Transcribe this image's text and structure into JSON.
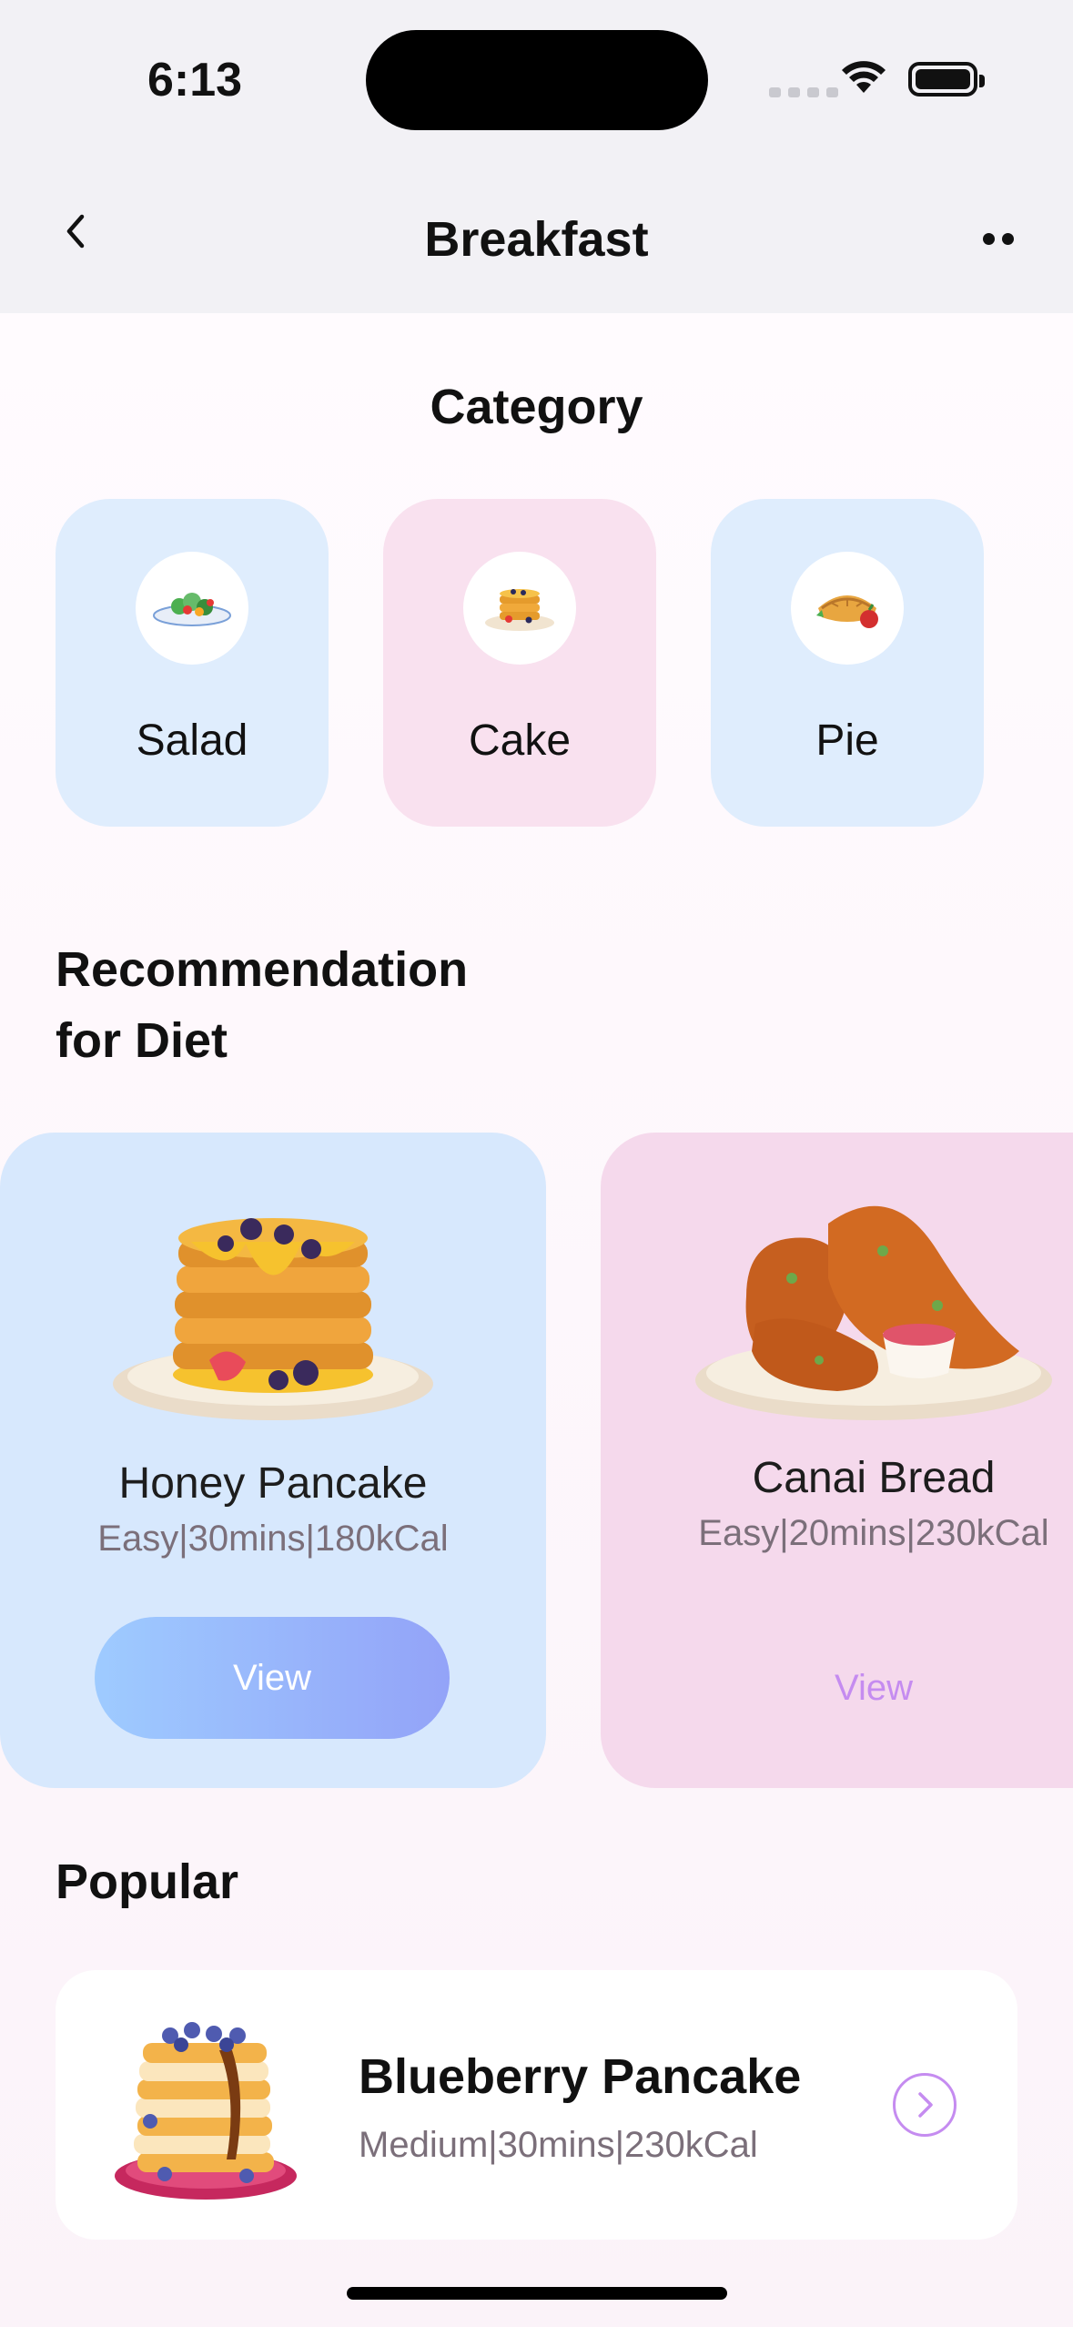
{
  "status_bar": {
    "time": "6:13"
  },
  "nav": {
    "title": "Breakfast",
    "back_icon": "chevron-left-icon",
    "more_icon": "more-dots-icon"
  },
  "category": {
    "heading": "Category",
    "items": [
      {
        "label": "Salad",
        "color": "#dfedfd",
        "icon": "salad-icon"
      },
      {
        "label": "Cake",
        "color": "#f9e1ef",
        "icon": "pancake-icon"
      },
      {
        "label": "Pie",
        "color": "#dfedfd",
        "icon": "pie-icon"
      }
    ]
  },
  "recommendation": {
    "heading_line1": "Recommendation",
    "heading_line2": "for Diet",
    "items": [
      {
        "name": "Honey Pancake",
        "meta": "Easy|30mins|180kCal",
        "button": "View",
        "color": "#d7e8fd"
      },
      {
        "name": "Canai Bread",
        "meta": "Easy|20mins|230kCal",
        "button": "View",
        "color": "#f5d9ec"
      }
    ]
  },
  "popular": {
    "heading": "Popular",
    "items": [
      {
        "name": "Blueberry Pancake",
        "meta": "Medium|30mins|230kCal",
        "arrow_icon": "chevron-right-circle-icon"
      }
    ]
  }
}
